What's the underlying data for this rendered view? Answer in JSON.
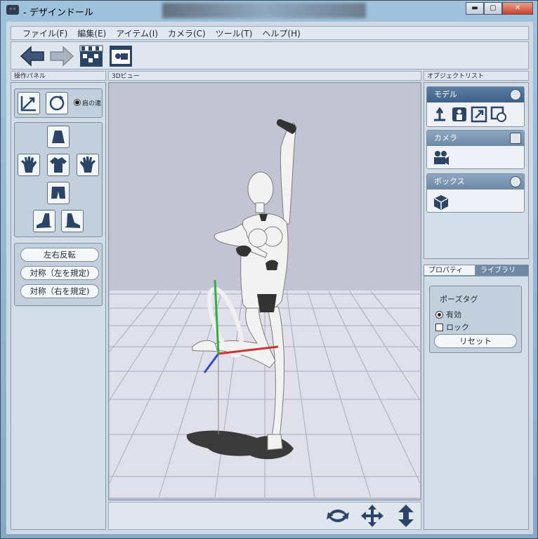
{
  "window": {
    "title": "- デザインドール",
    "app_icon": "doll-icon",
    "min": "▬",
    "max": "▢",
    "close": "✕"
  },
  "menu": [
    "ファイル(F)",
    "編集(E)",
    "アイテム(I)",
    "カメラ(C)",
    "ツール(T)",
    "ヘルプ(H)"
  ],
  "toolbar": {
    "icons": [
      "undo-arrow-icon",
      "redo-arrow-icon",
      "clapper-film-icon",
      "camera-film-icon"
    ]
  },
  "left_panel": {
    "title": "操作パネル",
    "mode_label": "肩の連",
    "part_icons": [
      "skirt-icon",
      "left-hand-icon",
      "shirt-icon",
      "right-hand-icon",
      "shorts-icon",
      "left-shoe-icon",
      "right-shoe-icon"
    ],
    "buttons": [
      "左右反転",
      "対称（左を規定)",
      "対称（右を規定)"
    ]
  },
  "viewport": {
    "title": "3Dビュー"
  },
  "object_list": {
    "title": "オブジェクトリスト",
    "items": [
      {
        "label": "モデル",
        "tools": [
          "anchor-icon",
          "body-icon",
          "scale-icon",
          "reset-icon"
        ]
      },
      {
        "label": "カメラ",
        "tools": [
          "video-camera-icon"
        ]
      },
      {
        "label": "ボックス",
        "tools": [
          "cube-icon"
        ]
      }
    ]
  },
  "tabs": {
    "properties": "プロパティ",
    "library": "ライブラリ"
  },
  "properties": {
    "group": "ポーズタグ",
    "enabled": "有効",
    "lock": "ロック",
    "reset": "リセット"
  },
  "bottom_tools": [
    "rotate-icon",
    "move-icon",
    "up-down-icon"
  ],
  "colors": {
    "accent": "#3f6189",
    "panel": "#d3dde8",
    "floor": "#e0e0ea",
    "sky": "#c2c4d4"
  }
}
